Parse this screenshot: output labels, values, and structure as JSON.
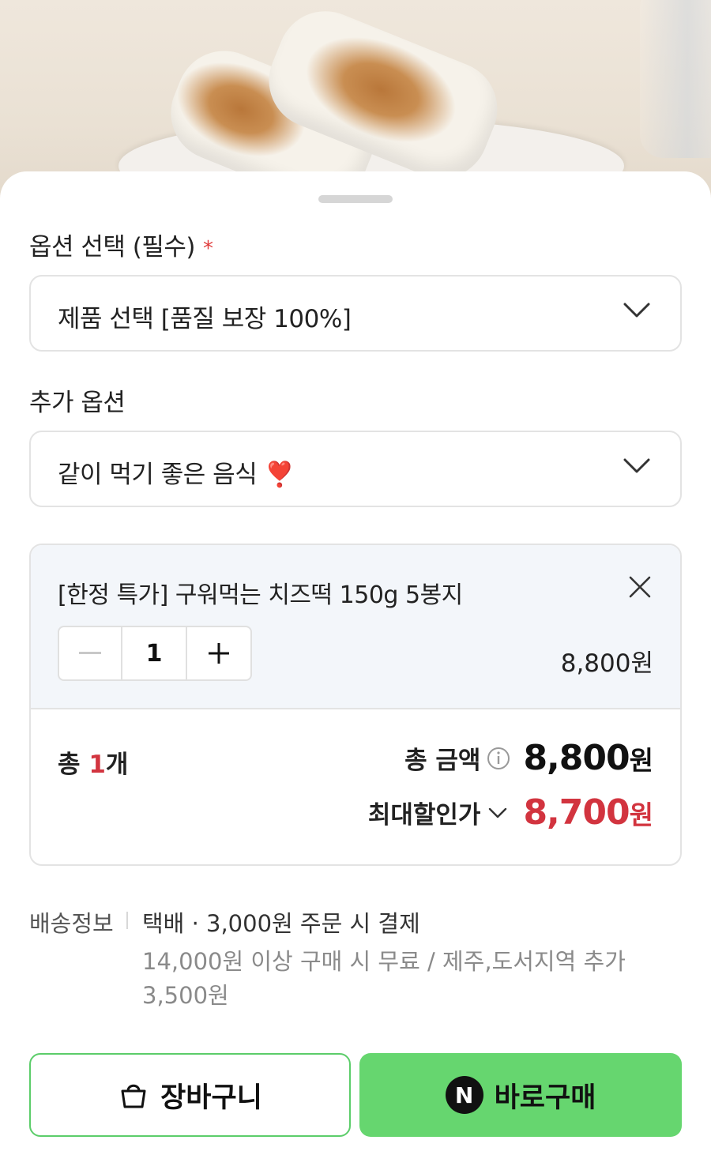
{
  "option": {
    "label": "옵션 선택 (필수)",
    "required_mark": "*",
    "selected": "제품 선택 [품질 보장 100%]"
  },
  "extra": {
    "label": "추가 옵션",
    "selected": "같이 먹기 좋은 음식 ❣️"
  },
  "cart_item": {
    "name": "[한정 특가] 구워먹는 치즈떡 150g 5봉지",
    "quantity": "1",
    "price": "8,800원"
  },
  "summary": {
    "count_prefix": "총 ",
    "count": "1",
    "count_suffix": "개",
    "total_label": "총 금액",
    "total_value": "8,800",
    "total_unit": "원",
    "discount_label": "최대할인가",
    "discount_value": "8,700",
    "discount_unit": "원"
  },
  "shipping": {
    "label": "배송정보",
    "main": "택배 · 3,000원 주문 시 결제",
    "sub": "14,000원 이상 구매 시 무료 / 제주,도서지역 추가 3,500원"
  },
  "buttons": {
    "cart": "장바구니",
    "buy_badge": "N",
    "buy": "바로구매"
  },
  "colors": {
    "accent_green": "#66d66f",
    "discount_red": "#d2343f"
  }
}
